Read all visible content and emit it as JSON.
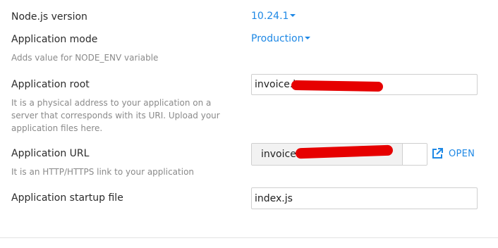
{
  "node_version": {
    "label": "Node.js version",
    "value": "10.24.1"
  },
  "app_mode": {
    "label": "Application mode",
    "value": "Production",
    "description": "Adds value for NODE_ENV variable"
  },
  "app_root": {
    "label": "Application root",
    "value": "invoice.k",
    "description": "It is a physical address to your application on a server that corresponds with its URI. Upload your application files here."
  },
  "app_url": {
    "label": "Application URL",
    "domain_value": "invoice.",
    "path_value": "",
    "description": "It is an HTTP/HTTPS link to your application",
    "open_label": "OPEN"
  },
  "startup_file": {
    "label": "Application startup file",
    "value": "index.js"
  },
  "colors": {
    "accent": "#1e88e5",
    "redaction": "#e60000"
  }
}
